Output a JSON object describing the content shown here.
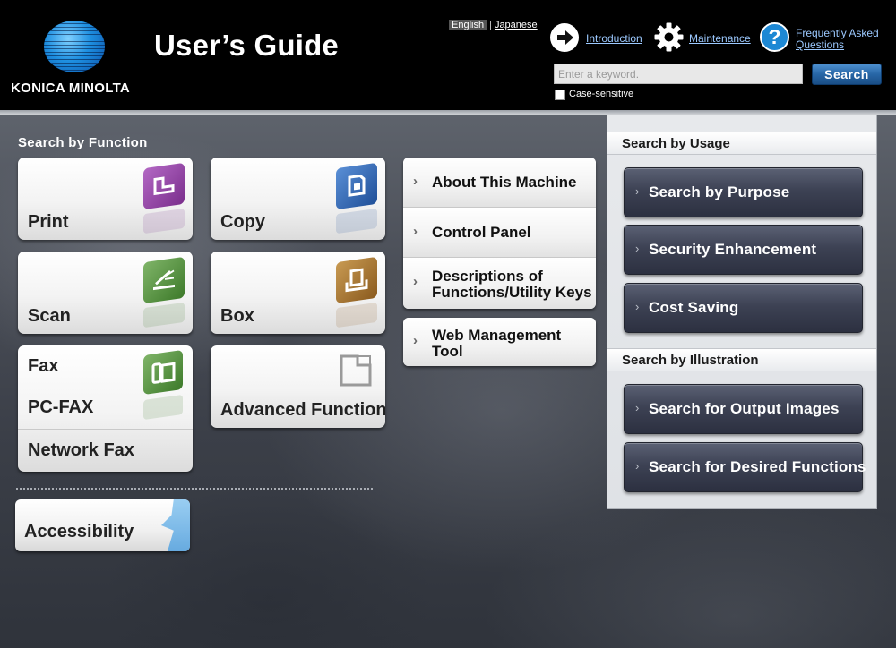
{
  "brand": {
    "logo_text": "KONICA MINOLTA"
  },
  "app": {
    "title": "User’s Guide"
  },
  "language": {
    "current": "English",
    "separator": "|",
    "other": "Japanese"
  },
  "nav": {
    "introduction": "Introduction",
    "maintenance": "Maintenance",
    "faq_line1": "Frequently Asked",
    "faq_line2": "Questions"
  },
  "search": {
    "placeholder": "Enter a keyword.",
    "value": "",
    "button_label": "Search",
    "case_sensitive_label": "Case-sensitive",
    "case_sensitive_checked": false
  },
  "search_by_function": {
    "heading": "Search by Function",
    "tiles": [
      {
        "label": "Print",
        "icon": "print-icon",
        "color": "#8a3f9a"
      },
      {
        "label": "Copy",
        "icon": "copy-icon",
        "color": "#2f64b0"
      },
      {
        "label": "Scan",
        "icon": "scan-icon",
        "color": "#4e8a3a"
      },
      {
        "label": "Box",
        "icon": "box-icon",
        "color": "#9a6a2a"
      },
      {
        "label": "Advanced Function",
        "icon": "advanced-function-icon",
        "color": "#9a9a9a"
      }
    ],
    "fax_tile": {
      "icon": "fax-icon",
      "color": "#4e8a3a",
      "items": [
        "Fax",
        "PC-FAX",
        "Network Fax"
      ]
    },
    "machine_list": [
      {
        "label": "About This Machine"
      },
      {
        "label": "Control Panel"
      },
      {
        "label_line1": "Descriptions of",
        "label_line2": "Functions/Utility Keys"
      }
    ],
    "web_management": {
      "label_line1": "Web Management",
      "label_line2": "Tool"
    },
    "accessibility": {
      "label": "Accessibility",
      "icon": "accessibility-icon"
    }
  },
  "search_by_usage": {
    "heading": "Search by Usage",
    "buttons": [
      "Search by Purpose",
      "Security Enhancement",
      "Cost Saving"
    ]
  },
  "search_by_illustration": {
    "heading": "Search by Illustration",
    "buttons": [
      "Search for Output Images",
      "Search for Desired Functions"
    ]
  }
}
